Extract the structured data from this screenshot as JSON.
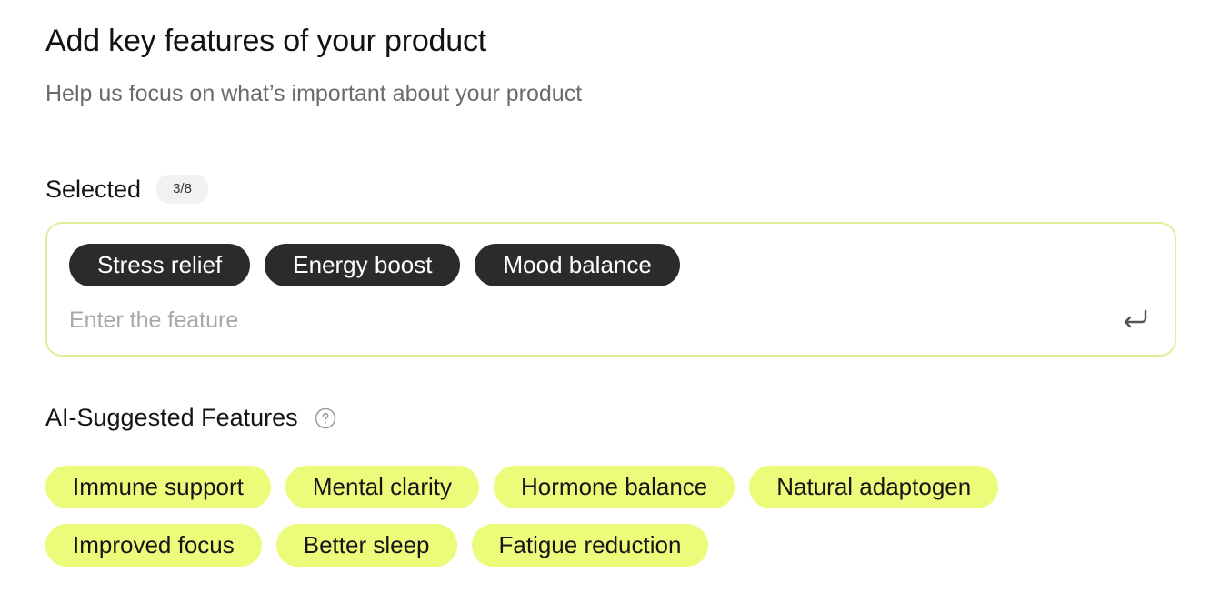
{
  "header": {
    "title": "Add key features of your product",
    "subtitle": "Help us focus on what’s important about your product"
  },
  "selected": {
    "label": "Selected",
    "count": "3/8",
    "chips": [
      "Stress relief",
      "Energy boost",
      "Mood balance"
    ],
    "input_placeholder": "Enter the feature",
    "input_value": "",
    "submit_icon": "enter-return-icon"
  },
  "suggested": {
    "label": "AI-Suggested Features",
    "help_icon": "question-circle-icon",
    "chips": [
      "Immune support",
      "Mental clarity",
      "Hormone balance",
      "Natural adaptogen",
      "Improved focus",
      "Better sleep",
      "Fatigue reduction"
    ]
  },
  "colors": {
    "selected_chip_bg": "#2b2b2b",
    "suggested_chip_bg": "#ecfb7a",
    "input_border": "#dcef9a",
    "badge_bg": "#f1f1f1"
  }
}
